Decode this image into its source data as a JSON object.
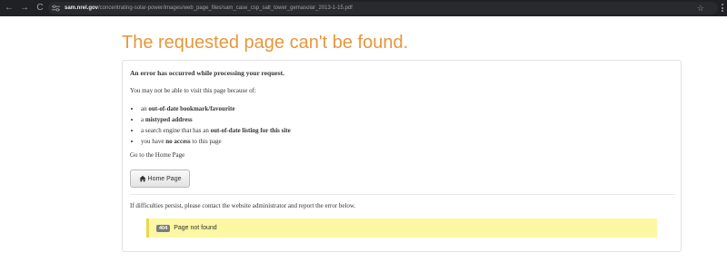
{
  "browser": {
    "url_domain": "sam.nrel.gov",
    "url_path": "/concentrating-solar-power/images/web_page_files/sam_case_csp_salt_tower_gemasolar_2013-1-15.pdf",
    "back_icon": "←",
    "forward_icon": "→",
    "reload_icon": "C",
    "star_icon": "☆"
  },
  "page": {
    "title": "The requested page can't be found."
  },
  "error": {
    "heading": "An error has occurred while processing your request.",
    "intro": "You may not be able to visit this page because of:",
    "reasons": [
      {
        "pre": "an ",
        "bold": "out-of-date bookmark/favourite",
        "post": ""
      },
      {
        "pre": "a ",
        "bold": "mistyped address",
        "post": ""
      },
      {
        "pre": "a search engine that has an ",
        "bold": "out-of-date listing for this site",
        "post": ""
      },
      {
        "pre": "you have ",
        "bold": "no access",
        "post": " to this page"
      }
    ],
    "goto_text": "Go to the Home Page",
    "home_button": "Home Page",
    "persist_text": "If difficulties persist, please contact the website administrator and report the error below.",
    "code": "404",
    "message": "Page not found"
  }
}
